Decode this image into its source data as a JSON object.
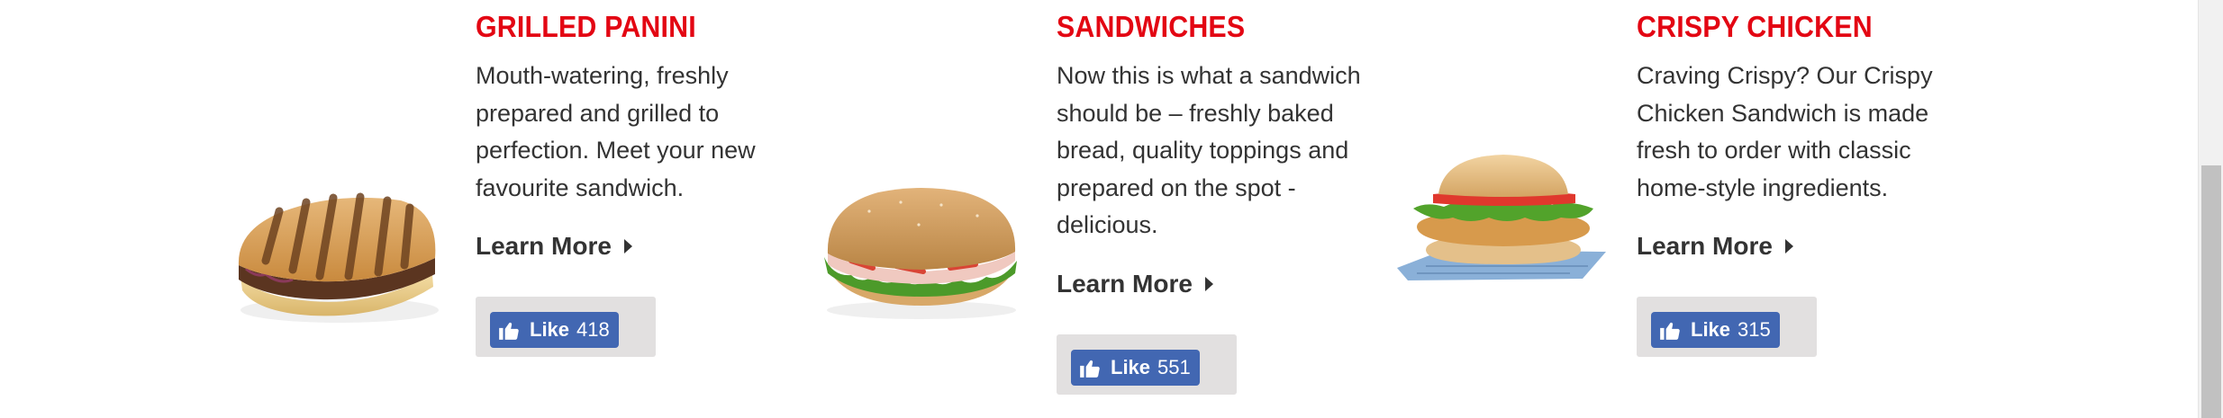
{
  "cards": [
    {
      "title": "GRILLED PANINI",
      "description": "Mouth-watering, freshly prepared and grilled to perfection. Meet your new favourite sandwich.",
      "learn_more": "Learn More",
      "like_label": "Like",
      "like_count": "418",
      "image_icon": "panini-image"
    },
    {
      "title": "SANDWICHES",
      "description": "Now this is what a sandwich should be – freshly baked bread, quality toppings and prepared on the spot - delicious.",
      "learn_more": "Learn More",
      "like_label": "Like",
      "like_count": "551",
      "image_icon": "sub-sandwich-image"
    },
    {
      "title": "CRISPY CHICKEN",
      "description": "Craving Crispy? Our Crispy Chicken Sandwich is made fresh to order with classic home-style ingredients.",
      "learn_more": "Learn More",
      "like_label": "Like",
      "like_count": "315",
      "image_icon": "crispy-chicken-image"
    }
  ],
  "colors": {
    "title_red": "#e30613",
    "body_text": "#333333",
    "facebook_blue": "#4267b2",
    "like_box_bg": "#e2e0e0"
  }
}
